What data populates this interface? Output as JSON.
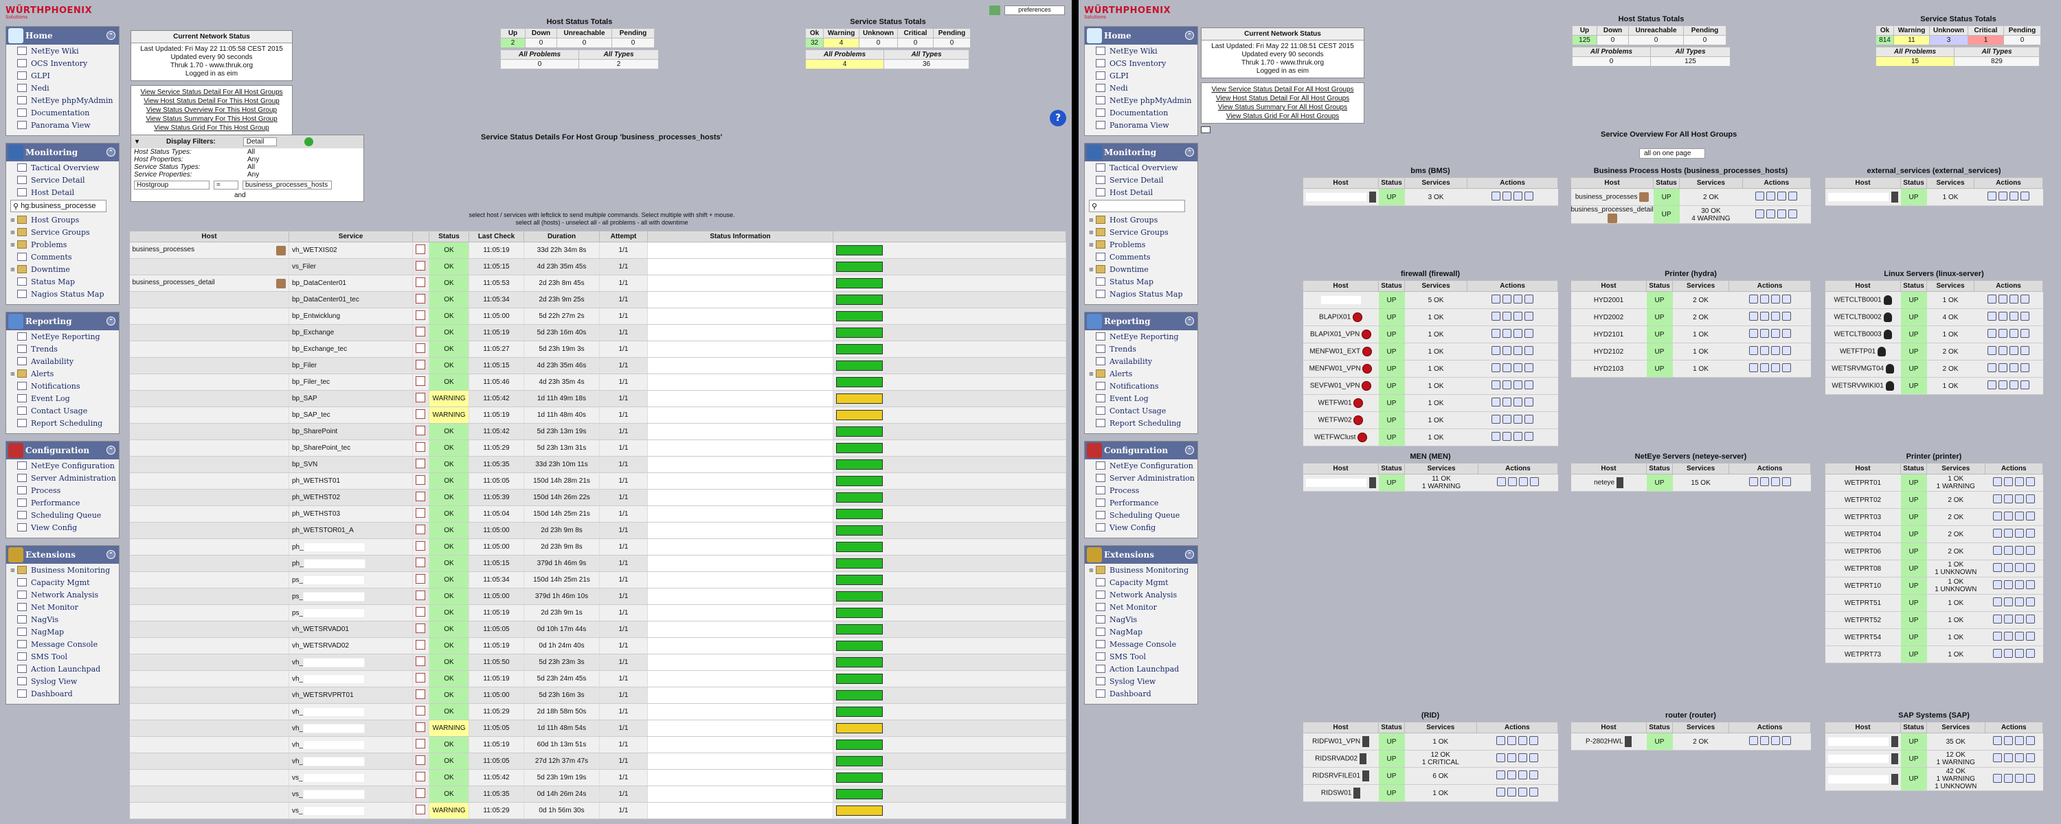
{
  "left": {
    "preferences": "preferences",
    "logo": {
      "line1": "WÜRTHPHOENIX",
      "line2": "Solutions"
    },
    "home": {
      "title": "Home",
      "items": [
        "NetEye Wiki",
        "OCS Inventory",
        "GLPI",
        "Nedi",
        "NetEye phpMyAdmin",
        "Documentation",
        "Panorama View"
      ]
    },
    "monitoring": {
      "title": "Monitoring",
      "items": [
        "Tactical Overview",
        "Service Detail",
        "Host Detail"
      ],
      "search_value": "hg:business_processe",
      "items2": [
        "Host Groups",
        "Service Groups",
        "Problems",
        "Comments",
        "Downtime",
        "Status Map",
        "Nagios Status Map"
      ]
    },
    "reporting": {
      "title": "Reporting",
      "items": [
        "NetEye Reporting",
        "Trends",
        "Availability",
        "Alerts",
        "Notifications",
        "Event Log",
        "Contact Usage",
        "Report Scheduling"
      ]
    },
    "configuration": {
      "title": "Configuration",
      "items": [
        "NetEye Configuration",
        "Server Administration",
        "Process",
        "Performance",
        "Scheduling Queue",
        "View Config"
      ]
    },
    "extensions": {
      "title": "Extensions",
      "items": [
        "Business Monitoring",
        "Capacity Mgmt",
        "Network Analysis",
        "Net Monitor",
        "NagVis",
        "NagMap",
        "Message Console",
        "SMS Tool",
        "Action Launchpad",
        "Syslog View",
        "Dashboard"
      ]
    },
    "net_status": {
      "title": "Current Network Status",
      "lines": [
        "Last Updated: Fri May 22 11:05:58 CEST 2015",
        "Updated every 90 seconds",
        "Thruk 1.70 - www.thruk.org",
        "Logged in as eim"
      ]
    },
    "links": [
      "View Service Status Detail For All Host Groups",
      "View Host Status Detail For This Host Group",
      "View Status Overview For This Host Group",
      "View Status Summary For This Host Group",
      "View Status Grid For This Host Group"
    ],
    "host_totals": {
      "title": "Host Status Totals",
      "headers": [
        "Up",
        "Down",
        "Unreachable",
        "Pending"
      ],
      "values": [
        "2",
        "0",
        "0",
        "0"
      ],
      "headers2": [
        "All Problems",
        "All Types"
      ],
      "values2": [
        "0",
        "2"
      ]
    },
    "service_totals": {
      "title": "Service Status Totals",
      "headers": [
        "Ok",
        "Warning",
        "Unknown",
        "Critical",
        "Pending"
      ],
      "values": [
        "32",
        "4",
        "0",
        "0",
        "0"
      ],
      "headers2": [
        "All Problems",
        "All Types"
      ],
      "values2": [
        "4",
        "36"
      ]
    },
    "filters": {
      "title": "Display Filters:",
      "mode": "Detail",
      "rows": [
        [
          "Host Status Types:",
          "All"
        ],
        [
          "Host Properties:",
          "Any"
        ],
        [
          "Service Status Types:",
          "All"
        ],
        [
          "Service Properties:",
          "Any"
        ]
      ],
      "field": "Hostgroup",
      "op": "=",
      "value": "business_processes_hosts",
      "and": "and"
    },
    "page_title": "Service Status Details For Host Group 'business_processes_hosts'",
    "hint1": "select host / services with leftclick to send multiple commands. Select multiple with shift + mouse.",
    "hint2": "select all (hosts) - unselect all - all problems - all with downtime",
    "columns": [
      "Host",
      "Service",
      "Status",
      "Last Check",
      "Duration",
      "Attempt",
      "Status Information"
    ],
    "rows": [
      {
        "host": "business_processes",
        "service": "vh_WETXIS02",
        "status": "OK",
        "last": "11:05:19",
        "dur": "33d 22h 34m 8s",
        "att": "1/1",
        "bar": "g"
      },
      {
        "host": "",
        "service": "vs_Filer",
        "status": "OK",
        "last": "11:05:15",
        "dur": "4d 23h 35m 45s",
        "att": "1/1",
        "bar": "g"
      },
      {
        "host": "business_processes_detail",
        "service": "bp_DataCenter01",
        "status": "OK",
        "last": "11:05:53",
        "dur": "2d 23h 8m 45s",
        "att": "1/1",
        "bar": "g"
      },
      {
        "host": "",
        "service": "bp_DataCenter01_tec",
        "status": "OK",
        "last": "11:05:34",
        "dur": "2d 23h 9m 25s",
        "att": "1/1",
        "bar": "g"
      },
      {
        "host": "",
        "service": "bp_Entwicklung",
        "status": "OK",
        "last": "11:05:00",
        "dur": "5d 22h 27m 2s",
        "att": "1/1",
        "bar": "g"
      },
      {
        "host": "",
        "service": "bp_Exchange",
        "status": "OK",
        "last": "11:05:19",
        "dur": "5d 23h 16m 40s",
        "att": "1/1",
        "bar": "g"
      },
      {
        "host": "",
        "service": "bp_Exchange_tec",
        "status": "OK",
        "last": "11:05:27",
        "dur": "5d 23h 19m 3s",
        "att": "1/1",
        "bar": "g"
      },
      {
        "host": "",
        "service": "bp_Filer",
        "status": "OK",
        "last": "11:05:15",
        "dur": "4d 23h 35m 46s",
        "att": "1/1",
        "bar": "g"
      },
      {
        "host": "",
        "service": "bp_Filer_tec",
        "status": "OK",
        "last": "11:05:46",
        "dur": "4d 23h 35m 4s",
        "att": "1/1",
        "bar": "g"
      },
      {
        "host": "",
        "service": "bp_SAP",
        "status": "WARNING",
        "last": "11:05:42",
        "dur": "1d 11h 49m 18s",
        "att": "1/1",
        "bar": "y"
      },
      {
        "host": "",
        "service": "bp_SAP_tec",
        "status": "WARNING",
        "last": "11:05:19",
        "dur": "1d 11h 48m 40s",
        "att": "1/1",
        "bar": "y"
      },
      {
        "host": "",
        "service": "bp_SharePoint",
        "status": "OK",
        "last": "11:05:42",
        "dur": "5d 23h 13m 19s",
        "att": "1/1",
        "bar": "g"
      },
      {
        "host": "",
        "service": "bp_SharePoint_tec",
        "status": "OK",
        "last": "11:05:29",
        "dur": "5d 23h 13m 31s",
        "att": "1/1",
        "bar": "g"
      },
      {
        "host": "",
        "service": "bp_SVN",
        "status": "OK",
        "last": "11:05:35",
        "dur": "33d 23h 10m 11s",
        "att": "1/1",
        "bar": "g"
      },
      {
        "host": "",
        "service": "ph_WETHST01",
        "status": "OK",
        "last": "11:05:05",
        "dur": "150d 14h 28m 21s",
        "att": "1/1",
        "bar": "g"
      },
      {
        "host": "",
        "service": "ph_WETHST02",
        "status": "OK",
        "last": "11:05:39",
        "dur": "150d 14h 26m 22s",
        "att": "1/1",
        "bar": "g"
      },
      {
        "host": "",
        "service": "ph_WETHST03",
        "status": "OK",
        "last": "11:05:04",
        "dur": "150d 14h 25m 21s",
        "att": "1/1",
        "bar": "g"
      },
      {
        "host": "",
        "service": "ph_WETSTOR01_A",
        "status": "OK",
        "last": "11:05:00",
        "dur": "2d 23h 9m 8s",
        "att": "1/1",
        "bar": "g"
      },
      {
        "host": "",
        "service": "ph_",
        "status": "OK",
        "last": "11:05:00",
        "dur": "2d 23h 9m 8s",
        "att": "1/1",
        "bar": "g",
        "red": true
      },
      {
        "host": "",
        "service": "ph_",
        "status": "OK",
        "last": "11:05:15",
        "dur": "379d 1h 46m 9s",
        "att": "1/1",
        "bar": "g",
        "red": true
      },
      {
        "host": "",
        "service": "ps_",
        "status": "OK",
        "last": "11:05:34",
        "dur": "150d 14h 25m 21s",
        "att": "1/1",
        "bar": "g",
        "red": true
      },
      {
        "host": "",
        "service": "ps_",
        "status": "OK",
        "last": "11:05:00",
        "dur": "379d 1h 46m 10s",
        "att": "1/1",
        "bar": "g",
        "red": true
      },
      {
        "host": "",
        "service": "ps_",
        "status": "OK",
        "last": "11:05:19",
        "dur": "2d 23h 9m 1s",
        "att": "1/1",
        "bar": "g",
        "red": true
      },
      {
        "host": "",
        "service": "vh_WETSRVAD01",
        "status": "OK",
        "last": "11:05:05",
        "dur": "0d 10h 17m 44s",
        "att": "1/1",
        "bar": "g"
      },
      {
        "host": "",
        "service": "vh_WETSRVAD02",
        "status": "OK",
        "last": "11:05:19",
        "dur": "0d 1h 24m 40s",
        "att": "1/1",
        "bar": "g"
      },
      {
        "host": "",
        "service": "vh_",
        "status": "OK",
        "last": "11:05:50",
        "dur": "5d 23h 23m 3s",
        "att": "1/1",
        "bar": "g",
        "red": true
      },
      {
        "host": "",
        "service": "vh_",
        "status": "OK",
        "last": "11:05:19",
        "dur": "5d 23h 24m 45s",
        "att": "1/1",
        "bar": "g",
        "red": true
      },
      {
        "host": "",
        "service": "vh_WETSRVPRT01",
        "status": "OK",
        "last": "11:05:00",
        "dur": "5d 23h 16m 3s",
        "att": "1/1",
        "bar": "g"
      },
      {
        "host": "",
        "service": "vh_",
        "status": "OK",
        "last": "11:05:29",
        "dur": "2d 18h 58m 50s",
        "att": "1/1",
        "bar": "g",
        "red": true
      },
      {
        "host": "",
        "service": "vh_",
        "status": "WARNING",
        "last": "11:05:05",
        "dur": "1d 11h 48m 54s",
        "att": "1/1",
        "bar": "y",
        "red": true
      },
      {
        "host": "",
        "service": "vh_",
        "status": "OK",
        "last": "11:05:19",
        "dur": "60d 1h 13m 51s",
        "att": "1/1",
        "bar": "g",
        "red": true
      },
      {
        "host": "",
        "service": "vh_",
        "status": "OK",
        "last": "11:05:05",
        "dur": "27d 12h 37m 47s",
        "att": "1/1",
        "bar": "g",
        "red": true
      },
      {
        "host": "",
        "service": "vs_",
        "status": "OK",
        "last": "11:05:42",
        "dur": "5d 23h 19m 19s",
        "att": "1/1",
        "bar": "g",
        "red": true
      },
      {
        "host": "",
        "service": "vs_",
        "status": "OK",
        "last": "11:05:35",
        "dur": "0d 14h 26m 24s",
        "att": "1/1",
        "bar": "g",
        "red": true
      },
      {
        "host": "",
        "service": "vs_",
        "status": "WARNING",
        "last": "11:05:29",
        "dur": "0d 1h 56m 30s",
        "att": "1/1",
        "bar": "y",
        "red": true
      }
    ]
  },
  "right": {
    "net_status": {
      "title": "Current Network Status",
      "lines": [
        "Last Updated: Fri May 22 11:08:51 CEST 2015",
        "Updated every 90 seconds",
        "Thruk 1.70 - www.thruk.org",
        "Logged in as eim"
      ]
    },
    "links": [
      "View Service Status Detail For All Host Groups",
      "View Host Status Detail For All Host Groups",
      "View Status Summary For All Host Groups",
      "View Status Grid For All Host Groups"
    ],
    "host_totals": {
      "title": "Host Status Totals",
      "headers": [
        "Up",
        "Down",
        "Unreachable",
        "Pending"
      ],
      "values": [
        "125",
        "0",
        "0",
        "0"
      ],
      "headers2": [
        "All Problems",
        "All Types"
      ],
      "values2": [
        "0",
        "125"
      ]
    },
    "service_totals": {
      "title": "Service Status Totals",
      "headers": [
        "Ok",
        "Warning",
        "Unknown",
        "Critical",
        "Pending"
      ],
      "values": [
        "814",
        "11",
        "3",
        "1",
        "0"
      ],
      "headers2": [
        "All Problems",
        "All Types"
      ],
      "values2": [
        "15",
        "829"
      ]
    },
    "overview_title": "Service Overview For All Host Groups",
    "page_select": "all on one page",
    "grid_headers": [
      "Host",
      "Status",
      "Services",
      "Actions"
    ],
    "groups": [
      {
        "title": "bms (BMS)",
        "rows": [
          {
            "host": "",
            "s": "UP",
            "svc": [
              "3 OK"
            ]
          }
        ]
      },
      {
        "title": "Business Process Hosts (business_processes_hosts)",
        "rows": [
          {
            "host": "business_processes",
            "s": "UP",
            "svc": [
              "2 OK"
            ]
          },
          {
            "host": "business_processes_detail",
            "s": "UP",
            "svc": [
              "30 OK",
              "4 WARNING"
            ]
          }
        ]
      },
      {
        "title": "external_services (external_services)",
        "rows": [
          {
            "host": "",
            "s": "UP",
            "svc": [
              "1 OK"
            ]
          }
        ]
      },
      {
        "title": "firewall (firewall)",
        "rows": [
          {
            "host": "",
            "s": "UP",
            "svc": [
              "5 OK"
            ]
          },
          {
            "host": "BLAPIX01",
            "s": "UP",
            "svc": [
              "1 OK"
            ]
          },
          {
            "host": "BLAPIX01_VPN",
            "s": "UP",
            "svc": [
              "1 OK"
            ]
          },
          {
            "host": "MENFW01_EXT",
            "s": "UP",
            "svc": [
              "1 OK"
            ]
          },
          {
            "host": "MENFW01_VPN",
            "s": "UP",
            "svc": [
              "1 OK"
            ]
          },
          {
            "host": "SEVFW01_VPN",
            "s": "UP",
            "svc": [
              "1 OK"
            ]
          },
          {
            "host": "WETFW01",
            "s": "UP",
            "svc": [
              "1 OK"
            ]
          },
          {
            "host": "WETFW02",
            "s": "UP",
            "svc": [
              "1 OK"
            ]
          },
          {
            "host": "WETFWClust",
            "s": "UP",
            "svc": [
              "1 OK"
            ]
          }
        ]
      },
      {
        "title": "Printer (hydra)",
        "rows": [
          {
            "host": "HYD2001",
            "s": "UP",
            "svc": [
              "2 OK"
            ]
          },
          {
            "host": "HYD2002",
            "s": "UP",
            "svc": [
              "2 OK"
            ]
          },
          {
            "host": "HYD2101",
            "s": "UP",
            "svc": [
              "1 OK"
            ]
          },
          {
            "host": "HYD2102",
            "s": "UP",
            "svc": [
              "1 OK"
            ]
          },
          {
            "host": "HYD2103",
            "s": "UP",
            "svc": [
              "1 OK"
            ]
          }
        ]
      },
      {
        "title": "Linux Servers (linux-server)",
        "rows": [
          {
            "host": "WETCLTB0001",
            "s": "UP",
            "svc": [
              "1 OK"
            ]
          },
          {
            "host": "WETCLTB0002",
            "s": "UP",
            "svc": [
              "4 OK"
            ]
          },
          {
            "host": "WETCLTB0003",
            "s": "UP",
            "svc": [
              "1 OK"
            ]
          },
          {
            "host": "WETFTP01",
            "s": "UP",
            "svc": [
              "2 OK"
            ]
          },
          {
            "host": "WETSRVMGT04",
            "s": "UP",
            "svc": [
              "2 OK"
            ]
          },
          {
            "host": "WETSRVWIKI01",
            "s": "UP",
            "svc": [
              "1 OK"
            ]
          }
        ]
      },
      {
        "title": "MEN (MEN)",
        "rows": [
          {
            "host": "",
            "s": "UP",
            "svc": [
              "11 OK",
              "1 WARNING"
            ]
          }
        ]
      },
      {
        "title": "NetEye Servers (neteye-server)",
        "rows": [
          {
            "host": "neteye",
            "s": "UP",
            "svc": [
              "15 OK"
            ]
          }
        ]
      },
      {
        "title": "Printer (printer)",
        "rows": [
          {
            "host": "WETPRT01",
            "s": "UP",
            "svc": [
              "1 OK",
              "1 WARNING"
            ]
          },
          {
            "host": "WETPRT02",
            "s": "UP",
            "svc": [
              "2 OK"
            ]
          },
          {
            "host": "WETPRT03",
            "s": "UP",
            "svc": [
              "2 OK"
            ]
          },
          {
            "host": "WETPRT04",
            "s": "UP",
            "svc": [
              "2 OK"
            ]
          },
          {
            "host": "WETPRT06",
            "s": "UP",
            "svc": [
              "2 OK"
            ]
          },
          {
            "host": "WETPRT08",
            "s": "UP",
            "svc": [
              "1 OK",
              "1 UNKNOWN"
            ]
          },
          {
            "host": "WETPRT10",
            "s": "UP",
            "svc": [
              "1 OK",
              "1 UNKNOWN"
            ]
          },
          {
            "host": "WETPRT51",
            "s": "UP",
            "svc": [
              "1 OK"
            ]
          },
          {
            "host": "WETPRT52",
            "s": "UP",
            "svc": [
              "1 OK"
            ]
          },
          {
            "host": "WETPRT54",
            "s": "UP",
            "svc": [
              "1 OK"
            ]
          },
          {
            "host": "WETPRT73",
            "s": "UP",
            "svc": [
              "1 OK"
            ]
          }
        ]
      },
      {
        "title": "(RID)",
        "rows": [
          {
            "host": "RIDFW01_VPN",
            "s": "UP",
            "svc": [
              "1 OK"
            ]
          },
          {
            "host": "RIDSRVAD02",
            "s": "UP",
            "svc": [
              "12 OK",
              "1 CRITICAL"
            ]
          },
          {
            "host": "RIDSRVFILE01",
            "s": "UP",
            "svc": [
              "6 OK"
            ]
          },
          {
            "host": "RIDSW01",
            "s": "UP",
            "svc": [
              "1 OK"
            ]
          }
        ]
      },
      {
        "title": "router (router)",
        "rows": [
          {
            "host": "P-2802HWL",
            "s": "UP",
            "svc": [
              "2 OK"
            ]
          }
        ]
      },
      {
        "title": "SAP Systems (SAP)",
        "rows": [
          {
            "host": "",
            "s": "UP",
            "svc": [
              "35 OK"
            ]
          },
          {
            "host": "",
            "s": "UP",
            "svc": [
              "12 OK",
              "1 WARNING"
            ]
          },
          {
            "host": "",
            "s": "UP",
            "svc": [
              "42 OK",
              "1 WARNING",
              "1 UNKNOWN"
            ]
          }
        ]
      }
    ]
  }
}
